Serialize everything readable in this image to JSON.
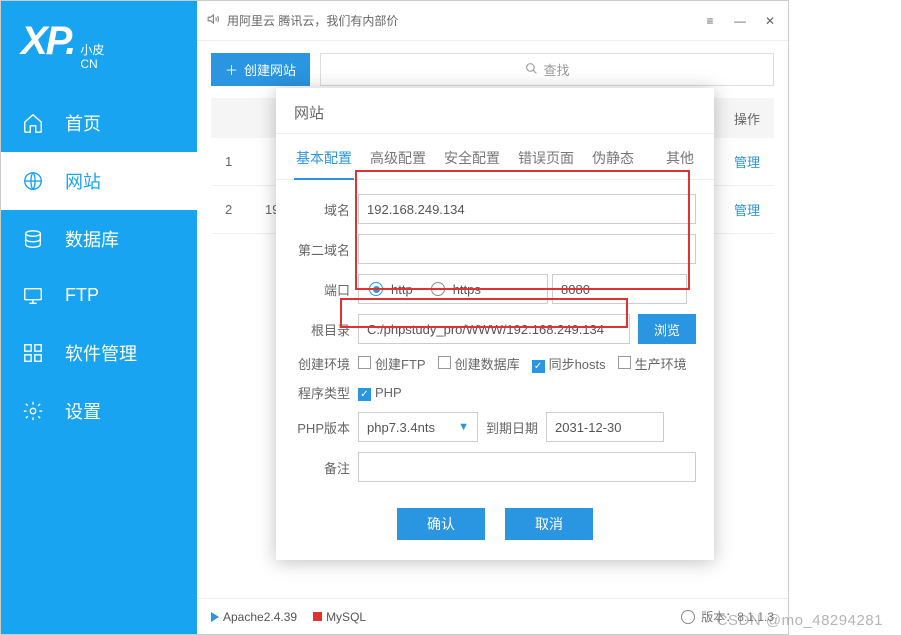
{
  "brand": {
    "xp": "XP.",
    "sub1": "小皮",
    "sub2": "CN"
  },
  "nav": {
    "home": "首页",
    "site": "网站",
    "db": "数据库",
    "ftp": "FTP",
    "software": "软件管理",
    "settings": "设置"
  },
  "announcement": "用阿里云 腾讯云，我们有内部价",
  "toolbar": {
    "create": "创建网站",
    "search": "查找"
  },
  "table": {
    "col_op": "操作",
    "rows": [
      {
        "idx": "1",
        "domain": "",
        "op": "管理"
      },
      {
        "idx": "2",
        "domain": "19",
        "op": "管理"
      }
    ]
  },
  "dialog": {
    "title": "网站",
    "tabs": {
      "basic": "基本配置",
      "adv": "高级配置",
      "sec": "安全配置",
      "err": "错误页面",
      "rewrite": "伪静态",
      "other": "其他"
    },
    "labels": {
      "domain": "域名",
      "domain2": "第二域名",
      "port": "端口",
      "root": "根目录",
      "env": "创建环境",
      "ptype": "程序类型",
      "phpver": "PHP版本",
      "expire": "到期日期",
      "note": "备注"
    },
    "values": {
      "domain": "192.168.249.134",
      "domain2": "",
      "port": "8080",
      "root": "C:/phpstudy_pro/WWW/192.168.249.134",
      "phpver": "php7.3.4nts",
      "expire": "2031-12-30",
      "note": ""
    },
    "proto": {
      "http": "http",
      "https": "https"
    },
    "env": {
      "ftp": "创建FTP",
      "db": "创建数据库",
      "hosts": "同步hosts",
      "prod": "生产环境"
    },
    "ptype_php": "PHP",
    "browse": "浏览",
    "ok": "确认",
    "cancel": "取消"
  },
  "footer": {
    "apache": "Apache2.4.39",
    "mysql": "MySQL",
    "version_label": "版本：",
    "version": "8.1.1.3"
  },
  "watermark": "CSDN @mo_48294281"
}
